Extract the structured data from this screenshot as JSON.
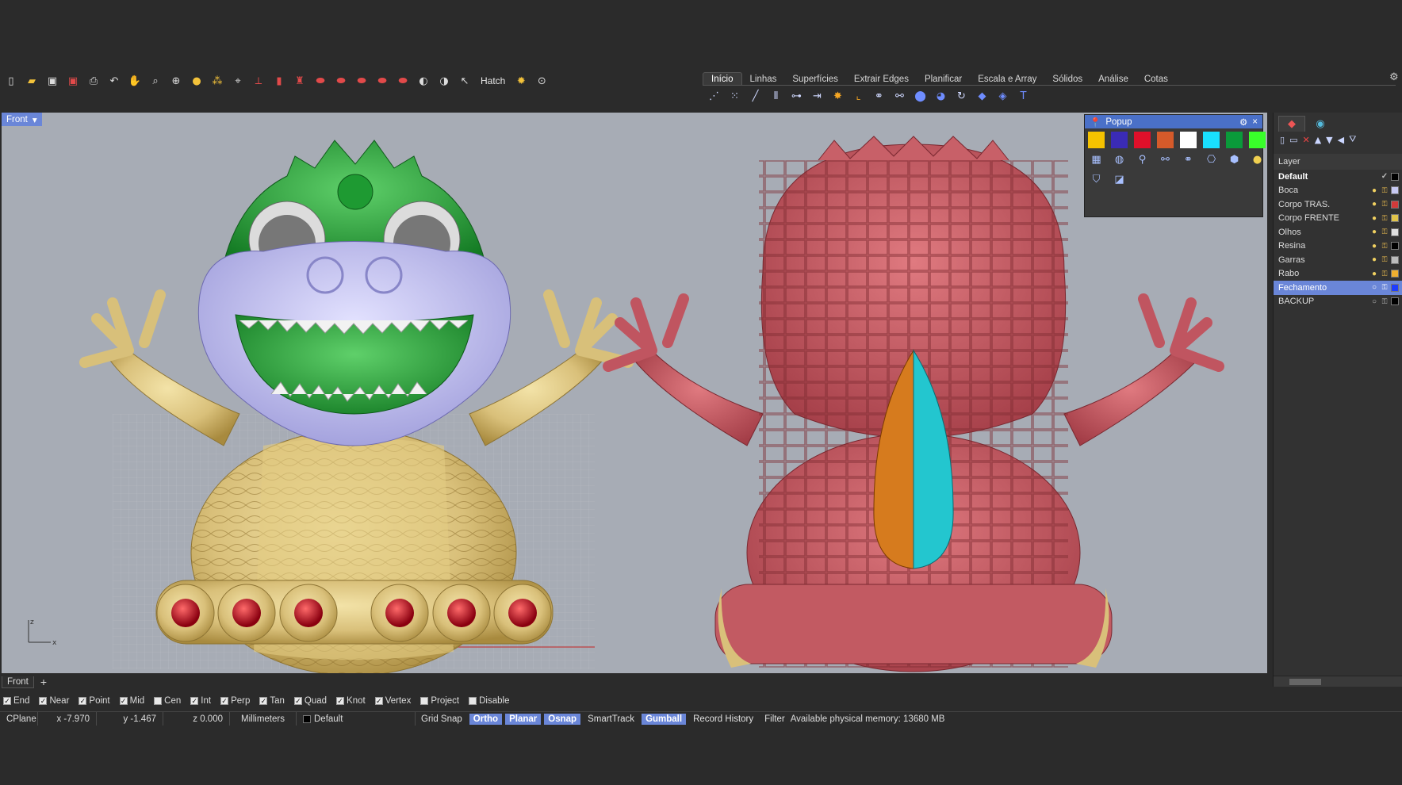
{
  "toolbar": {
    "hatch_label": "Hatch"
  },
  "tabs": [
    {
      "label": "Início",
      "active": true
    },
    {
      "label": "Linhas"
    },
    {
      "label": "Superfícies"
    },
    {
      "label": "Extrair Edges"
    },
    {
      "label": "Planificar"
    },
    {
      "label": "Escala e Array"
    },
    {
      "label": "Sólidos"
    },
    {
      "label": "Análise"
    },
    {
      "label": "Cotas"
    }
  ],
  "viewport": {
    "label": "Front",
    "axis_z": "z",
    "axis_x": "x"
  },
  "popup": {
    "title": "Popup",
    "swatches": [
      "#f5c200",
      "#3a2bb5",
      "#e0102a",
      "#d55a2a",
      "#ffffff",
      "#19e0ff",
      "#0a9a3a",
      "#39ff2a"
    ]
  },
  "layers": {
    "header": "Layer",
    "items": [
      {
        "name": "Default",
        "current": true,
        "color": "#000000"
      },
      {
        "name": "Boca",
        "color": "#c7c9f2"
      },
      {
        "name": "Corpo TRAS.",
        "color": "#d23a3a"
      },
      {
        "name": "Corpo FRENTE",
        "color": "#e0c44a"
      },
      {
        "name": "Olhos",
        "color": "#e0e0e0"
      },
      {
        "name": "Resina",
        "color": "#000000"
      },
      {
        "name": "Garras",
        "color": "#bcbcbc"
      },
      {
        "name": "Rabo",
        "color": "#f0b030"
      },
      {
        "name": "Fechamento",
        "selected": true,
        "color": "#1e3cff"
      },
      {
        "name": "BACKUP",
        "color": "#000000"
      }
    ]
  },
  "viewport_tabs": {
    "front": "Front",
    "add": "+"
  },
  "osnap": [
    {
      "label": "End",
      "checked": true
    },
    {
      "label": "Near",
      "checked": true
    },
    {
      "label": "Point",
      "checked": true
    },
    {
      "label": "Mid",
      "checked": true
    },
    {
      "label": "Cen",
      "checked": false
    },
    {
      "label": "Int",
      "checked": true
    },
    {
      "label": "Perp",
      "checked": true
    },
    {
      "label": "Tan",
      "checked": true
    },
    {
      "label": "Quad",
      "checked": true
    },
    {
      "label": "Knot",
      "checked": true
    },
    {
      "label": "Vertex",
      "checked": true
    },
    {
      "label": "Project",
      "checked": false
    },
    {
      "label": "Disable",
      "checked": false
    }
  ],
  "status": {
    "cplane": "CPlane",
    "x": "x -7.970",
    "y": "y -1.467",
    "z": "z 0.000",
    "units": "Millimeters",
    "layer": "Default",
    "grid_snap": "Grid Snap",
    "ortho": "Ortho",
    "planar": "Planar",
    "osnap": "Osnap",
    "smarttrack": "SmartTrack",
    "gumball": "Gumball",
    "record_history": "Record History",
    "filter": "Filter",
    "memory": "Available physical memory: 13680 MB"
  }
}
